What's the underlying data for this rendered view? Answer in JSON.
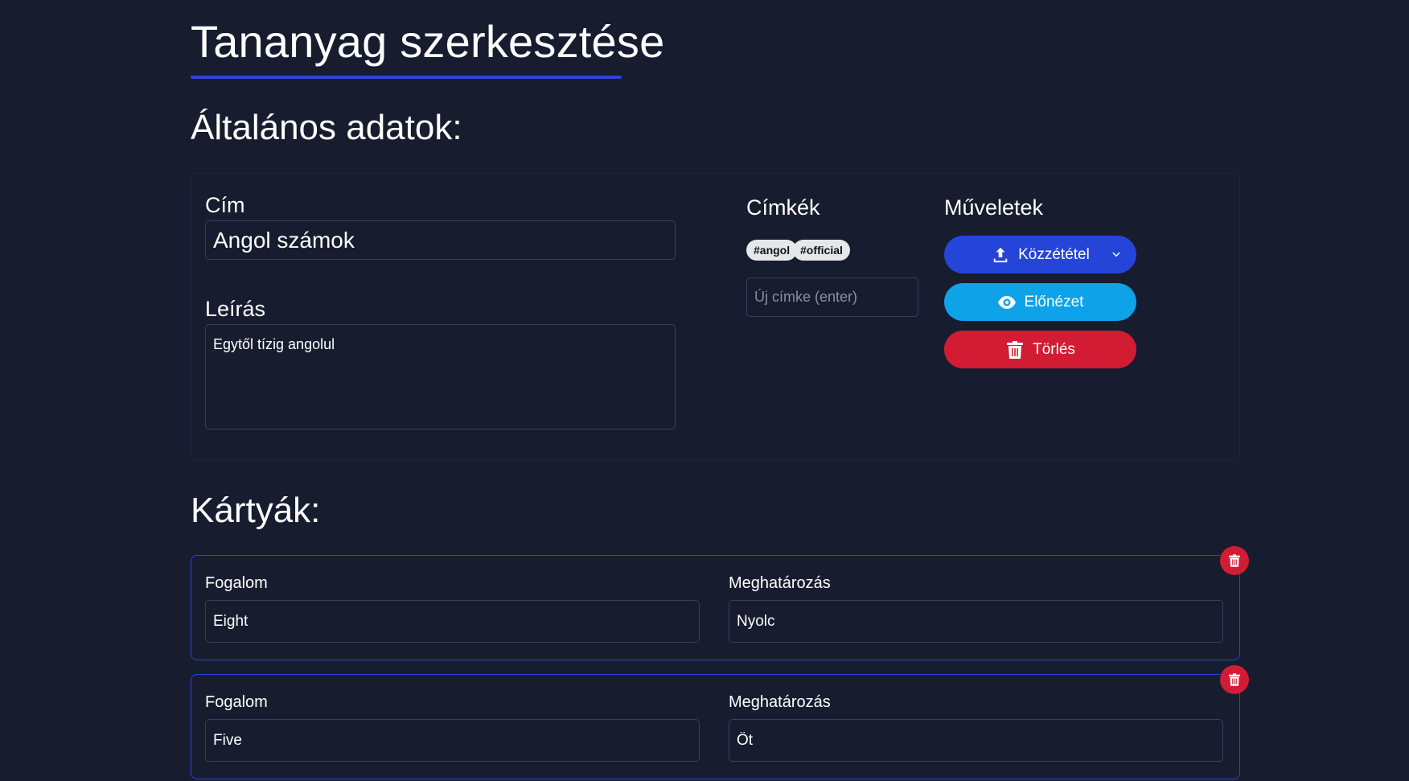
{
  "page": {
    "title": "Tananyag szerkesztése"
  },
  "general": {
    "heading": "Általános adatok:",
    "title_label": "Cím",
    "title_value": "Angol számok",
    "description_label": "Leírás",
    "description_value": "Egytől tízig angolul"
  },
  "tags": {
    "heading": "Címkék",
    "items": [
      "#angol",
      "#official"
    ],
    "new_tag_placeholder": "Új címke (enter)"
  },
  "actions": {
    "heading": "Műveletek",
    "publish_label": "Közzététel",
    "preview_label": "Előnézet",
    "delete_label": "Törlés"
  },
  "cards": {
    "heading": "Kártyák:",
    "items": [
      {
        "term_label": "Fogalom",
        "term_value": "Eight",
        "definition_label": "Meghatározás",
        "definition_value": "Nyolc"
      },
      {
        "term_label": "Fogalom",
        "term_value": "Five",
        "definition_label": "Meghatározás",
        "definition_value": "Öt"
      }
    ]
  },
  "colors": {
    "background": "#171c2f",
    "accent": "#2b44d8",
    "publish": "#2545d9",
    "preview": "#0ea2e8",
    "danger": "#d21c33"
  },
  "icons": {
    "publish": "upload-icon",
    "publish_dropdown": "chevron-down-icon",
    "preview": "eye-icon",
    "delete": "trash-icon",
    "card_delete": "trash-icon"
  }
}
